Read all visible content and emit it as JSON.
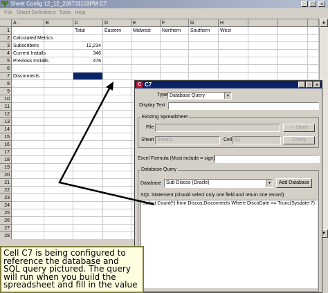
{
  "window": {
    "title": "Sheet Config 12_12_200731103PM  C7"
  },
  "menu": [
    "File",
    "Sheet Definitions",
    "Tools",
    "Help"
  ],
  "grid": {
    "columns": [
      "A",
      "B",
      "C",
      "D",
      "E",
      "F",
      "G",
      "H"
    ],
    "rows": [
      "1",
      "2",
      "3",
      "4",
      "5",
      "6",
      "7",
      "8",
      "9",
      "10",
      "11",
      "12",
      "13",
      "14",
      "15",
      "16",
      "17",
      "18",
      "19",
      "20",
      "21",
      "22",
      "23",
      "24",
      "25",
      "26",
      "27",
      "28",
      "29"
    ],
    "cells": {
      "r1": {
        "c": "Total",
        "d": "Eastern",
        "e": "Midwest",
        "f": "Northern",
        "g": "Southern",
        "h": "West"
      },
      "r2": {
        "a": "Calculated Metrics"
      },
      "r3": {
        "a": "Subscribers",
        "c": "12,234"
      },
      "r4": {
        "a": "Current Installs",
        "c": "346"
      },
      "r5": {
        "a": "Previous Installs",
        "c": "476"
      },
      "r7": {
        "a": "Disconnects"
      }
    },
    "selected_cell": "C7"
  },
  "dialog": {
    "title": "C7",
    "icon_letter": "C",
    "type_label": "Type",
    "type_value": "Database Query",
    "display_text_label": "Display Text",
    "existing_group": "Existing Spreadsheet",
    "file_label": "File",
    "open_button": "Open",
    "sheet_label": "Sheet",
    "sheet_value": "Sheet1",
    "cell_label": "Cell",
    "cell_value": "A1",
    "check_button": "Check",
    "excel_formula_label": "Excel Formula (Must include = sign)",
    "dbquery_group": "Database Query",
    "database_label": "Database",
    "database_value": "Sub Discos (Oracle)",
    "add_database_button": "Add Database",
    "sql_label": "SQL Statement (should select only one field and return one record)",
    "sql_value": "Select Count(*) from Discos.Disconnects Where DiscoDate >= Trunc(Sysdate-7)"
  },
  "caption": {
    "lines": [
      "Cell C7 is being configured to",
      "reference the database and",
      "SQL query pictured. The query",
      "will run when you build the",
      "spreadsheet and fill in the value"
    ]
  },
  "colors": {
    "title_active": "#0a246a",
    "selection": "#0a246a",
    "caption_bg": "#fffde0"
  }
}
